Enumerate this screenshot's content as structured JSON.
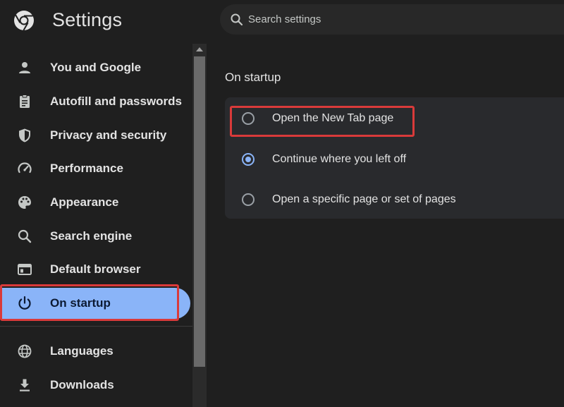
{
  "app": {
    "title": "Settings",
    "logo_icon": "chrome-logo"
  },
  "search": {
    "placeholder": "Search settings",
    "icon": "search-icon"
  },
  "sidebar": {
    "items": [
      {
        "label": "You and Google",
        "icon": "person-icon"
      },
      {
        "label": "Autofill and passwords",
        "icon": "clipboard-icon"
      },
      {
        "label": "Privacy and security",
        "icon": "shield-icon"
      },
      {
        "label": "Performance",
        "icon": "speedometer-icon"
      },
      {
        "label": "Appearance",
        "icon": "palette-icon"
      },
      {
        "label": "Search engine",
        "icon": "search-icon"
      },
      {
        "label": "Default browser",
        "icon": "browser-window-icon"
      },
      {
        "label": "On startup",
        "icon": "power-icon",
        "active": true
      },
      {
        "label": "Languages",
        "icon": "globe-icon"
      },
      {
        "label": "Downloads",
        "icon": "download-icon"
      }
    ]
  },
  "main": {
    "section_title": "On startup",
    "options": [
      {
        "label": "Open the New Tab page",
        "checked": false
      },
      {
        "label": "Continue where you left off",
        "checked": true
      },
      {
        "label": "Open a specific page or set of pages",
        "checked": false
      }
    ]
  },
  "colors": {
    "background": "#1f1f1f",
    "card": "#292a2d",
    "accent": "#8ab4f8",
    "highlight_border": "#d93a3a"
  }
}
